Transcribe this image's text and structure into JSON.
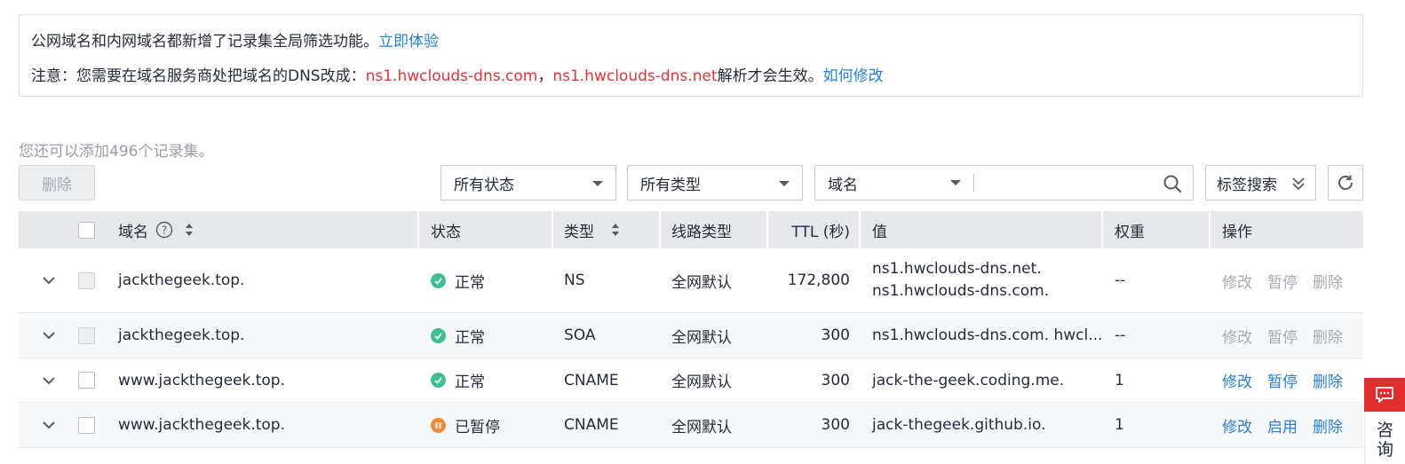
{
  "notice": {
    "line1_text": "公网域名和内网域名都新增了记录集全局筛选功能。",
    "line1_link": "立即体验",
    "line2_prefix": "注意：您需要在域名服务商处把域名的DNS改成：",
    "line2_ns1": "ns1.hwclouds-dns.com",
    "line2_sep": "，",
    "line2_ns2": "ns1.hwclouds-dns.net",
    "line2_suffix": "解析才会生效。",
    "line2_link": "如何修改"
  },
  "quota_text": "您还可以添加496个记录集。",
  "toolbar": {
    "delete_label": "删除",
    "status_select": "所有状态",
    "type_select": "所有类型",
    "search_field": "域名",
    "search_placeholder": "",
    "tag_search": "标签搜索",
    "icons": {
      "search": "search-icon",
      "refresh": "refresh-icon",
      "tag_expand": "double-chevron-down-icon"
    }
  },
  "table": {
    "headers": {
      "domain": "域名",
      "status": "状态",
      "type": "类型",
      "line": "线路类型",
      "ttl": "TTL (秒)",
      "value": "值",
      "weight": "权重",
      "ops": "操作"
    },
    "rows": [
      {
        "domain": "jackthegeek.top.",
        "status": "正常",
        "status_kind": "ok",
        "type": "NS",
        "line": "全网默认",
        "ttl": "172,800",
        "value": [
          "ns1.hwclouds-dns.net.",
          "ns1.hwclouds-dns.com."
        ],
        "weight": "--",
        "ops": [
          "修改",
          "暂停",
          "删除"
        ],
        "ops_enabled": false,
        "checkbox_enabled": false
      },
      {
        "domain": "jackthegeek.top.",
        "status": "正常",
        "status_kind": "ok",
        "type": "SOA",
        "line": "全网默认",
        "ttl": "300",
        "value": [
          "ns1.hwclouds-dns.com. hwcl..."
        ],
        "weight": "--",
        "ops": [
          "修改",
          "暂停",
          "删除"
        ],
        "ops_enabled": false,
        "checkbox_enabled": false
      },
      {
        "domain": "www.jackthegeek.top.",
        "status": "正常",
        "status_kind": "ok",
        "type": "CNAME",
        "line": "全网默认",
        "ttl": "300",
        "value": [
          "jack-the-geek.coding.me."
        ],
        "weight": "1",
        "ops": [
          "修改",
          "暂停",
          "删除"
        ],
        "ops_enabled": true,
        "checkbox_enabled": true
      },
      {
        "domain": "www.jackthegeek.top.",
        "status": "已暂停",
        "status_kind": "paused",
        "type": "CNAME",
        "line": "全网默认",
        "ttl": "300",
        "value": [
          "jack-thegeek.github.io."
        ],
        "weight": "1",
        "ops": [
          "修改",
          "启用",
          "删除"
        ],
        "ops_enabled": true,
        "checkbox_enabled": true
      }
    ]
  },
  "consult": {
    "label_1": "咨",
    "label_2": "询"
  },
  "colors": {
    "link": "#2a7fd4",
    "warning_red": "#d9363e",
    "status_ok": "#3fbe94",
    "status_paused": "#f08a3b",
    "consult_red": "#e02d2d"
  }
}
